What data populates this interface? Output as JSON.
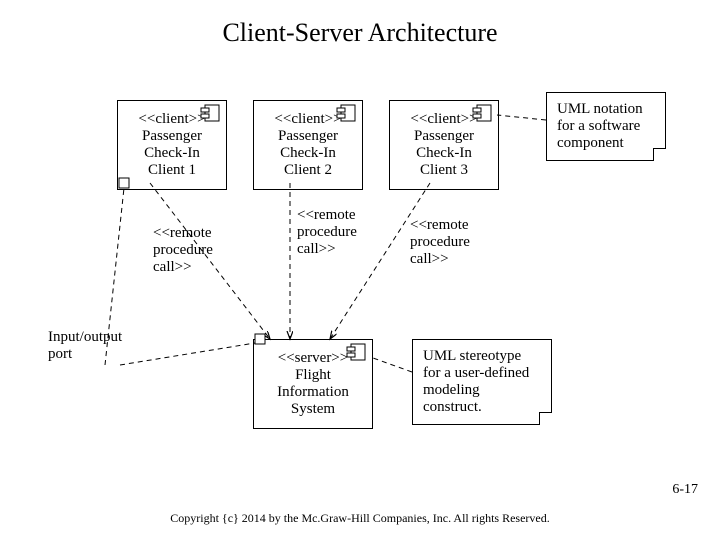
{
  "title": "Client-Server Architecture",
  "clients": [
    {
      "stereotype": "<<client>>",
      "l1": "Passenger",
      "l2": "Check-In",
      "l3": "Client 1"
    },
    {
      "stereotype": "<<client>>",
      "l1": "Passenger",
      "l2": "Check-In",
      "l3": "Client 2"
    },
    {
      "stereotype": "<<client>>",
      "l1": "Passenger",
      "l2": "Check-In",
      "l3": "Client 3"
    }
  ],
  "server": {
    "stereotype": "<<server>>",
    "l1": "Flight",
    "l2": "Information",
    "l3": "System"
  },
  "rpc": [
    {
      "t": "<<remote procedure call>>"
    },
    {
      "t": "<<remote procedure call>>"
    },
    {
      "t": "<<remote procedure call>>"
    }
  ],
  "notes": {
    "uml_component": "UML notation for a software component",
    "uml_stereotype": "UML stereotype for a user-defined modeling construct."
  },
  "io_port": "Input/output port",
  "page": "6-17",
  "copyright": "Copyright {c} 2014 by the Mc.Graw-Hill Companies, Inc. All rights Reserved."
}
